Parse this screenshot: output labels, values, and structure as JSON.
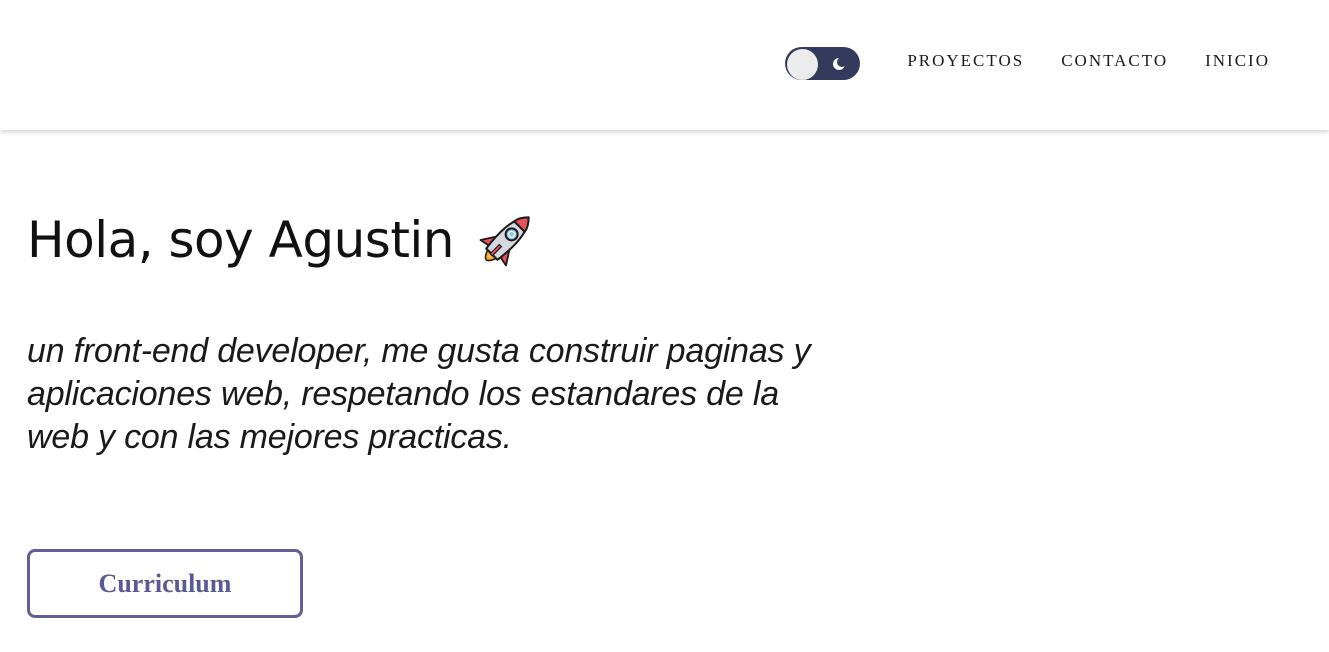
{
  "header": {
    "theme_toggle": {
      "state": "light",
      "icon": "moon-icon"
    },
    "nav": [
      {
        "label": "PROYECTOS"
      },
      {
        "label": "CONTACTO"
      },
      {
        "label": "INICIO"
      }
    ]
  },
  "hero": {
    "title": "Hola, soy Agustin",
    "title_icon": "rocket-icon",
    "description": "un front-end developer, me gusta construir paginas y aplicaciones web, respetando los estandares de la web y con las mejores practicas.",
    "cta_label": "Curriculum"
  },
  "colors": {
    "toggle_track": "#333a5c",
    "button_accent": "#625f99",
    "text": "#111111",
    "background": "#ffffff"
  }
}
